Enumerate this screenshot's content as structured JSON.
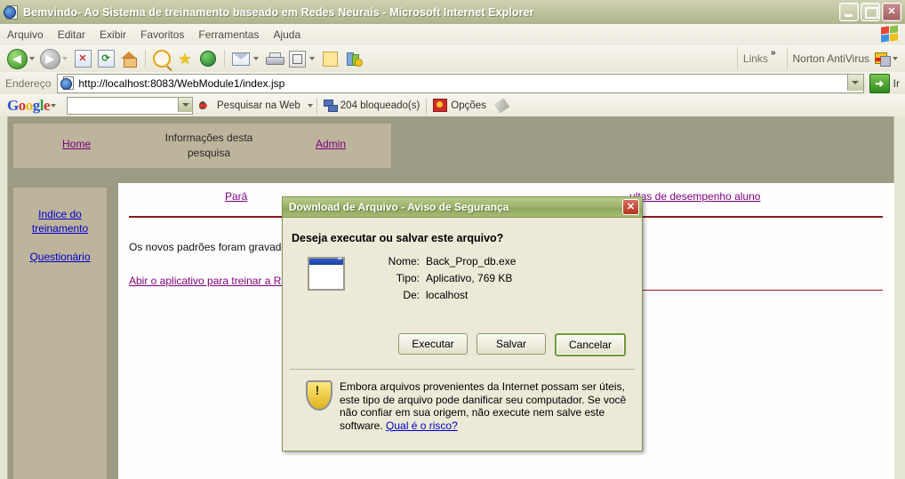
{
  "window": {
    "title": "Bemvindo- Ao Sistema de treinamento baseado em Redes Neurais - Microsoft Internet Explorer",
    "minimize_label": "",
    "maximize_label": "",
    "close_label": "✕"
  },
  "menu": {
    "items": [
      {
        "label": "Arquivo"
      },
      {
        "label": "Editar"
      },
      {
        "label": "Exibir"
      },
      {
        "label": "Favoritos"
      },
      {
        "label": "Ferramentas"
      },
      {
        "label": "Ajuda"
      }
    ]
  },
  "toolbar": {
    "links_label": "Links",
    "links_chevron": "»",
    "norton_label": "Norton AntiVirus"
  },
  "address": {
    "label": "Endereço",
    "url": "http://localhost:8083/WebModule1/index.jsp",
    "go_label": "Ir"
  },
  "google": {
    "logo": {
      "g1": "G",
      "o1": "o",
      "o2": "o",
      "g2": "g",
      "l": "l",
      "e": "e"
    },
    "search_value": "",
    "search_placeholder": "",
    "search_web_label": "Pesquisar na Web",
    "blocked_label": "204 bloqueado(s)",
    "options_label": "Opções"
  },
  "page": {
    "nav": {
      "home": "Home",
      "info": "Informações desta pesquisa",
      "admin": "Admin"
    },
    "sidebar": {
      "items": [
        {
          "label": "Indice do treinamento"
        },
        {
          "label": "Questionário"
        }
      ]
    },
    "content": {
      "link_parametros": "Parâ",
      "link_consultas": "ultas de desempenho aluno",
      "paragraph": "Os novos padrões foram gravados c",
      "link_abrir": "Abir o aplicativo para treinar a Rede"
    }
  },
  "dialog": {
    "title": "Download de Arquivo - Aviso de Segurança",
    "close_label": "✕",
    "question": "Deseja executar ou salvar este arquivo?",
    "fields": [
      {
        "label": "Nome:",
        "value": "Back_Prop_db.exe"
      },
      {
        "label": "Tipo:",
        "value": "Aplicativo, 769 KB"
      },
      {
        "label": "De:",
        "value": "localhost"
      }
    ],
    "buttons": {
      "run": "Executar",
      "save": "Salvar",
      "cancel": "Cancelar"
    },
    "warning_text": "Embora arquivos provenientes da Internet possam ser úteis, este tipo de arquivo pode danificar seu computador. Se você não confiar em sua origem, não execute nem salve este software. ",
    "warning_link": "Qual é o risco?",
    "shield_glyph": "!"
  },
  "colors": {
    "title_bar": "#b6bb94",
    "dialog_title": "#9fb56d",
    "page_bg": "#9d9b83",
    "panel_bg": "#bdb49c",
    "link_purple": "#800080",
    "link_blue": "#0000c8",
    "rule_red": "#8b1a1a"
  }
}
